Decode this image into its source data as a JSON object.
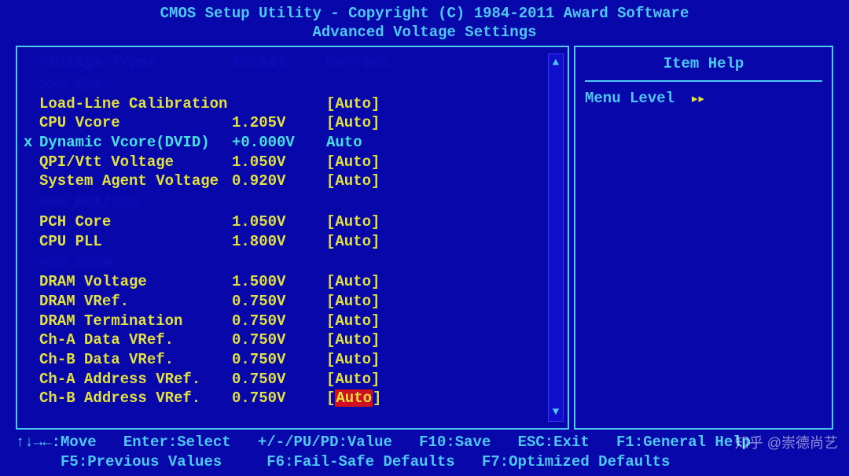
{
  "header": {
    "line1": "CMOS Setup Utility - Copyright (C) 1984-2011 Award Software",
    "line2": "Advanced Voltage Settings"
  },
  "columns": {
    "label": "Voltage Types",
    "normal": "Normal",
    "current": "Current"
  },
  "sections": {
    "cpu": ">>> CPU",
    "mch": ">>> MCH/ICH",
    "dram": ">>> DRAM"
  },
  "rows": {
    "r0": {
      "label": "Load-Line Calibration",
      "normal": "",
      "value": "Auto",
      "bracket": true
    },
    "r1": {
      "label": "CPU Vcore",
      "normal": "1.205V",
      "value": "Auto",
      "bracket": true
    },
    "r2": {
      "label": "Dynamic Vcore(DVID)",
      "normal": "+0.000V",
      "value": "Auto",
      "bracket": false,
      "active": true
    },
    "r3": {
      "label": "QPI/Vtt Voltage",
      "normal": "1.050V",
      "value": "Auto",
      "bracket": true
    },
    "r4": {
      "label": "System Agent Voltage",
      "normal": "0.920V",
      "value": "Auto",
      "bracket": true
    },
    "r5": {
      "label": "PCH Core",
      "normal": "1.050V",
      "value": "Auto",
      "bracket": true
    },
    "r6": {
      "label": "CPU PLL",
      "normal": "1.800V",
      "value": "Auto",
      "bracket": true
    },
    "r7": {
      "label": "DRAM Voltage",
      "normal": "1.500V",
      "value": "Auto",
      "bracket": true
    },
    "r8": {
      "label": "DRAM VRef.",
      "normal": "0.750V",
      "value": "Auto",
      "bracket": true
    },
    "r9": {
      "label": "DRAM Termination",
      "normal": "0.750V",
      "value": "Auto",
      "bracket": true
    },
    "r10": {
      "label": "Ch-A Data VRef.",
      "normal": "0.750V",
      "value": "Auto",
      "bracket": true
    },
    "r11": {
      "label": "Ch-B Data VRef.",
      "normal": "0.750V",
      "value": "Auto",
      "bracket": true
    },
    "r12": {
      "label": "Ch-A Address VRef.",
      "normal": "0.750V",
      "value": "Auto",
      "bracket": true
    },
    "r13": {
      "label": "Ch-B Address VRef.",
      "normal": "0.750V",
      "value": "Auto",
      "bracket": true,
      "highlight": true
    }
  },
  "help": {
    "title": "Item Help",
    "menu_level": "Menu Level",
    "arrows": "▸▸"
  },
  "footer": {
    "l1a": "↑↓→←:Move",
    "l1b": "Enter:Select",
    "l1c": "+/-/PU/PD:Value",
    "l1d": "F10:Save",
    "l1e": "ESC:Exit",
    "l1f": "F1:General Help",
    "l2a": "F5:Previous Values",
    "l2b": "F6:Fail-Safe Defaults",
    "l2c": "F7:Optimized Defaults"
  },
  "watermark": "知乎 @崇德尚艺"
}
